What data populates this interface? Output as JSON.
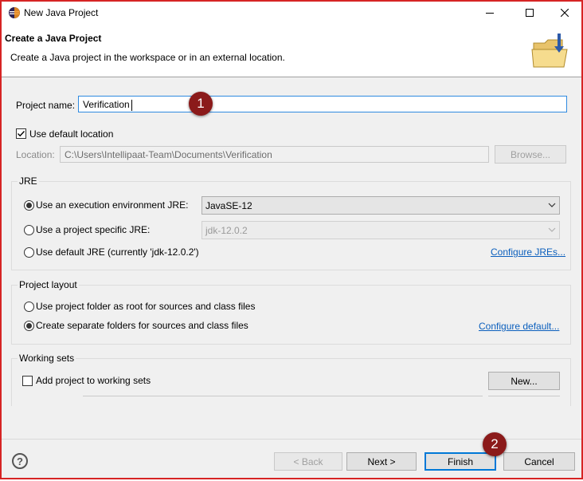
{
  "window": {
    "title": "New Java Project"
  },
  "banner": {
    "title": "Create a Java Project",
    "description": "Create a Java project in the workspace or in an external location."
  },
  "project_name": {
    "label": "Project name:",
    "value": "Verification"
  },
  "use_default_location": {
    "label": "Use default location",
    "checked": true
  },
  "location": {
    "label": "Location:",
    "value": "C:\\Users\\Intellipaat-Team\\Documents\\Verification",
    "browse_label": "Browse..."
  },
  "jre": {
    "group_title": "JRE",
    "option_execution_env": "Use an execution environment JRE:",
    "execution_env_value": "JavaSE-12",
    "option_project_specific": "Use a project specific JRE:",
    "project_specific_value": "jdk-12.0.2",
    "option_default": "Use default JRE (currently 'jdk-12.0.2')",
    "configure_link": "Configure JREs..."
  },
  "layout": {
    "group_title": "Project layout",
    "option_project_root": "Use project folder as root for sources and class files",
    "option_separate": "Create separate folders for sources and class files",
    "configure_link": "Configure default..."
  },
  "working_sets": {
    "group_title": "Working sets",
    "add_label": "Add project to working sets",
    "new_label": "New..."
  },
  "footer": {
    "back_label": "< Back",
    "next_label": "Next >",
    "finish_label": "Finish",
    "cancel_label": "Cancel"
  },
  "annotations": {
    "badge1": "1",
    "badge2": "2"
  },
  "colors": {
    "annotation": "#8b1a1a",
    "frame": "#d62424",
    "link": "#0b5fbd",
    "focus": "#0078d7"
  }
}
